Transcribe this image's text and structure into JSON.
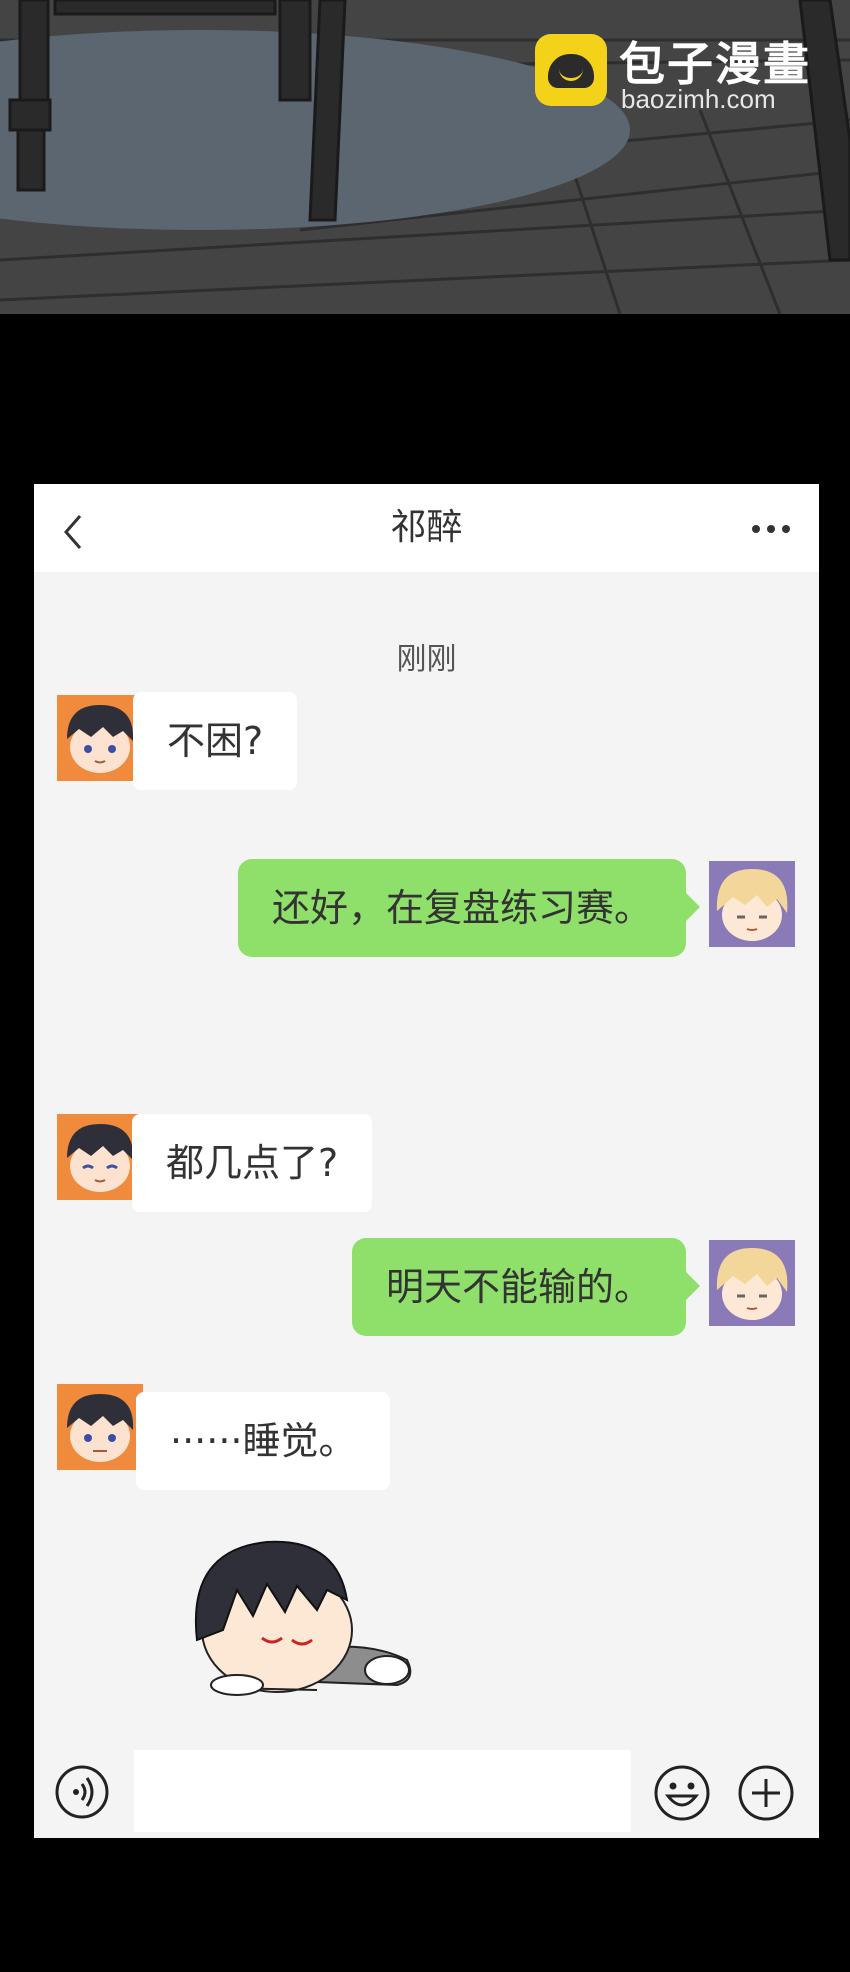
{
  "watermark": {
    "title": "包子漫畫",
    "url": "baozimh.com"
  },
  "chat": {
    "title": "祁醉",
    "timestamp": "刚刚",
    "messages": [
      {
        "side": "in",
        "text": "不困?"
      },
      {
        "side": "out",
        "text": "还好，在复盘练习赛。"
      },
      {
        "side": "in",
        "text": "都几点了?"
      },
      {
        "side": "out",
        "text": "明天不能输的。"
      },
      {
        "side": "in",
        "text": "······睡觉。"
      }
    ],
    "sticker": "sleeping-boy-sticker"
  },
  "input": {
    "placeholder": "",
    "value": ""
  },
  "icons": {
    "back": "chevron-left-icon",
    "more": "more-dots-icon",
    "voice": "voice-icon",
    "emoji": "emoji-icon",
    "plus": "plus-icon"
  },
  "colors": {
    "outgoing_bubble": "#8fe06a",
    "incoming_bubble": "#ffffff",
    "chat_background": "#f4f4f4",
    "avatar_left_bg": "#f08a3c",
    "avatar_right_bg": "#8a7bb8"
  }
}
